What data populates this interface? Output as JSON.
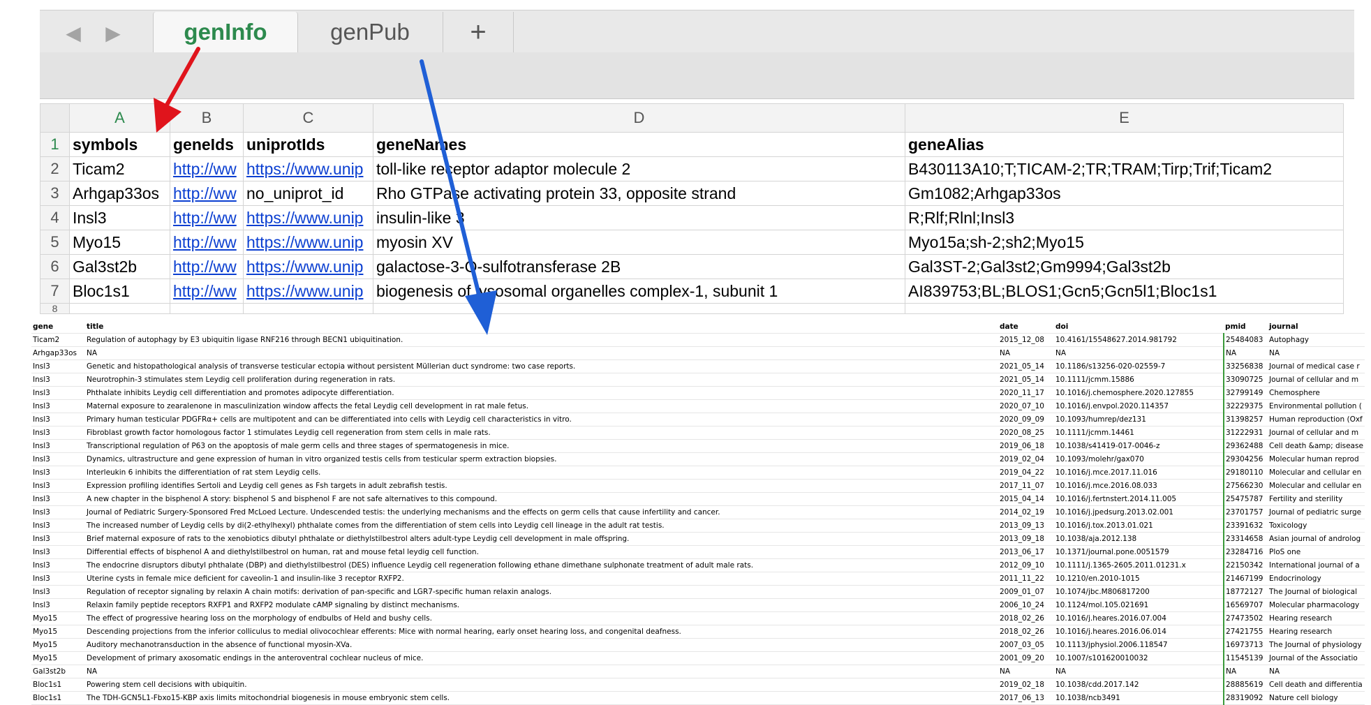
{
  "tabs": {
    "back_glyph": "◀",
    "forward_glyph": "▶",
    "active": "genInfo",
    "inactive": "genPub",
    "add": "+"
  },
  "grid": {
    "col_letters": [
      "A",
      "B",
      "C",
      "D",
      "E"
    ],
    "row_numbers": [
      "1",
      "2",
      "3",
      "4",
      "5",
      "6",
      "7",
      "8"
    ],
    "header": [
      "symbols",
      "geneIds",
      "uniprotIds",
      "geneNames",
      "geneAlias"
    ],
    "rows": [
      [
        "Ticam2",
        "http://ww",
        "https://www.unip",
        "toll-like receptor adaptor molecule 2",
        "B430113A10;T;TICAM-2;TR;TRAM;Tirp;Trif;Ticam2"
      ],
      [
        "Arhgap33os",
        "http://ww",
        "no_uniprot_id",
        "Rho GTPase activating protein 33, opposite strand",
        "Gm1082;Arhgap33os"
      ],
      [
        "Insl3",
        "http://ww",
        "https://www.unip",
        "insulin-like 3",
        "R;Rlf;Rlnl;Insl3"
      ],
      [
        "Myo15",
        "http://ww",
        "https://www.unip",
        "myosin XV",
        "Myo15a;sh-2;sh2;Myo15"
      ],
      [
        "Gal3st2b",
        "http://ww",
        "https://www.unip",
        "galactose-3-O-sulfotransferase 2B",
        "Gal3ST-2;Gal3st2;Gm9994;Gal3st2b"
      ],
      [
        "Bloc1s1",
        "http://ww",
        "https://www.unip",
        "biogenesis of lysosomal organelles complex-1, subunit 1",
        "AI839753;BL;BLOS1;Gcn5;Gcn5l1;Bloc1s1"
      ]
    ]
  },
  "pub": {
    "header": [
      "gene",
      "title",
      "date",
      "doi",
      "pmid",
      "journal"
    ],
    "rows": [
      [
        "Ticam2",
        "Regulation of autophagy by E3 ubiquitin ligase RNF216 through BECN1 ubiquitination.",
        "2015_12_08",
        "10.4161/15548627.2014.981792",
        "25484083",
        "Autophagy"
      ],
      [
        "Arhgap33os",
        "NA",
        "NA",
        "NA",
        "NA",
        "NA"
      ],
      [
        "Insl3",
        "Genetic and histopathological analysis of transverse testicular ectopia without persistent Müllerian duct syndrome: two case reports.",
        "2021_05_14",
        "10.1186/s13256-020-02559-7",
        "33256838",
        "Journal of medical case r"
      ],
      [
        "Insl3",
        "Neurotrophin-3 stimulates stem Leydig cell proliferation during regeneration in rats.",
        "2021_05_14",
        "10.1111/jcmm.15886",
        "33090725",
        "Journal of cellular and m"
      ],
      [
        "Insl3",
        "Phthalate inhibits Leydig cell differentiation and promotes adipocyte differentiation.",
        "2020_11_17",
        "10.1016/j.chemosphere.2020.127855",
        "32799149",
        "Chemosphere"
      ],
      [
        "Insl3",
        "Maternal exposure to zearalenone in masculinization window affects the fetal Leydig cell development in rat male fetus.",
        "2020_07_10",
        "10.1016/j.envpol.2020.114357",
        "32229375",
        "Environmental pollution ("
      ],
      [
        "Insl3",
        "Primary human testicular PDGFRα+ cells are multipotent and can be differentiated into cells with Leydig cell characteristics in vitro.",
        "2020_09_09",
        "10.1093/humrep/dez131",
        "31398257",
        "Human reproduction (Oxf"
      ],
      [
        "Insl3",
        "Fibroblast growth factor homologous factor 1 stimulates Leydig cell regeneration from stem cells in male rats.",
        "2020_08_25",
        "10.1111/jcmm.14461",
        "31222931",
        "Journal of cellular and m"
      ],
      [
        "Insl3",
        "Transcriptional regulation of P63 on the apoptosis of male germ cells and three stages of spermatogenesis in mice.",
        "2019_06_18",
        "10.1038/s41419-017-0046-z",
        "29362488",
        "Cell death &amp; disease"
      ],
      [
        "Insl3",
        "Dynamics, ultrastructure and gene expression of human in vitro organized testis cells from testicular sperm extraction biopsies.",
        "2019_02_04",
        "10.1093/molehr/gax070",
        "29304256",
        "Molecular human reprod"
      ],
      [
        "Insl3",
        "Interleukin 6 inhibits the differentiation of rat stem Leydig cells.",
        "2019_04_22",
        "10.1016/j.mce.2017.11.016",
        "29180110",
        "Molecular and cellular en"
      ],
      [
        "Insl3",
        "Expression profiling identifies Sertoli and Leydig cell genes as Fsh targets in adult zebrafish testis.",
        "2017_11_07",
        "10.1016/j.mce.2016.08.033",
        "27566230",
        "Molecular and cellular en"
      ],
      [
        "Insl3",
        "A new chapter in the bisphenol A story: bisphenol S and bisphenol F are not safe alternatives to this compound.",
        "2015_04_14",
        "10.1016/j.fertnstert.2014.11.005",
        "25475787",
        "Fertility and sterility"
      ],
      [
        "Insl3",
        "Journal of Pediatric Surgery-Sponsored Fred McLoed Lecture. Undescended testis: the underlying mechanisms and the effects on germ cells that cause infertility and cancer.",
        "2014_02_19",
        "10.1016/j.jpedsurg.2013.02.001",
        "23701757",
        "Journal of pediatric surge"
      ],
      [
        "Insl3",
        "The increased number of Leydig cells by di(2-ethylhexyl) phthalate comes from the differentiation of stem cells into Leydig cell lineage in the adult rat testis.",
        "2013_09_13",
        "10.1016/j.tox.2013.01.021",
        "23391632",
        "Toxicology"
      ],
      [
        "Insl3",
        "Brief maternal exposure of rats to the xenobiotics dibutyl phthalate or diethylstilbestrol alters adult-type Leydig cell development in male offspring.",
        "2013_09_18",
        "10.1038/aja.2012.138",
        "23314658",
        "Asian journal of androlog"
      ],
      [
        "Insl3",
        "Differential effects of bisphenol A and diethylstilbestrol on human, rat and mouse fetal leydig cell function.",
        "2013_06_17",
        "10.1371/journal.pone.0051579",
        "23284716",
        "PloS one"
      ],
      [
        "Insl3",
        "The endocrine disruptors dibutyl phthalate (DBP) and diethylstilbestrol (DES) influence Leydig cell regeneration following ethane dimethane sulphonate treatment of adult male rats.",
        "2012_09_10",
        "10.1111/j.1365-2605.2011.01231.x",
        "22150342",
        "International journal of a"
      ],
      [
        "Insl3",
        "Uterine cysts in female mice deficient for caveolin-1 and insulin-like 3 receptor RXFP2.",
        "2011_11_22",
        "10.1210/en.2010-1015",
        "21467199",
        "Endocrinology"
      ],
      [
        "Insl3",
        "Regulation of receptor signaling by relaxin A chain motifs: derivation of pan-specific and LGR7-specific human relaxin analogs.",
        "2009_01_07",
        "10.1074/jbc.M806817200",
        "18772127",
        "The Journal of biological"
      ],
      [
        "Insl3",
        "Relaxin family peptide receptors RXFP1 and RXFP2 modulate cAMP signaling by distinct mechanisms.",
        "2006_10_24",
        "10.1124/mol.105.021691",
        "16569707",
        "Molecular pharmacology"
      ],
      [
        "Myo15",
        "The effect of progressive hearing loss on the morphology of endbulbs of Held and bushy cells.",
        "2018_02_26",
        "10.1016/j.heares.2016.07.004",
        "27473502",
        "Hearing research"
      ],
      [
        "Myo15",
        "Descending projections from the inferior colliculus to medial olivocochlear efferents: Mice with normal hearing, early onset hearing loss, and congenital deafness.",
        "2018_02_26",
        "10.1016/j.heares.2016.06.014",
        "27421755",
        "Hearing research"
      ],
      [
        "Myo15",
        "Auditory mechanotransduction in the absence of functional myosin-XVa.",
        "2007_03_05",
        "10.1113/jphysiol.2006.118547",
        "16973713",
        "The Journal of physiology"
      ],
      [
        "Myo15",
        "Development of primary axosomatic endings in the anteroventral cochlear nucleus of mice.",
        "2001_09_20",
        "10.1007/s101620010032",
        "11545139",
        "Journal of the Associatio"
      ],
      [
        "Gal3st2b",
        "NA",
        "NA",
        "NA",
        "NA",
        "NA"
      ],
      [
        "Bloc1s1",
        "Powering stem cell decisions with ubiquitin.",
        "2019_02_18",
        "10.1038/cdd.2017.142",
        "28885619",
        "Cell death and differentia"
      ],
      [
        "Bloc1s1",
        "The TDH-GCN5L1-Fbxo15-KBP axis limits mitochondrial biogenesis in mouse embryonic stem cells.",
        "2017_06_13",
        "10.1038/ncb3491",
        "28319092",
        "Nature cell biology"
      ]
    ]
  },
  "colors": {
    "active_tab": "#2d8a4e",
    "link": "#0b3fd1",
    "red_arrow": "#e0141c",
    "blue_arrow": "#1f5fd6"
  }
}
